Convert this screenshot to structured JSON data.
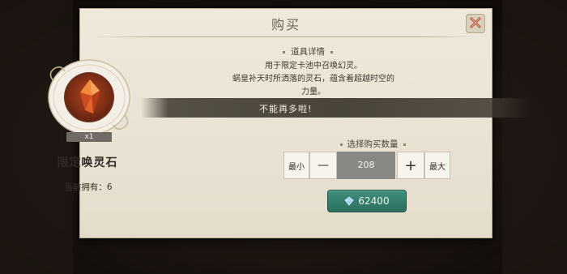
{
  "dialog": {
    "title": "购买",
    "close_icon": "close-x-icon"
  },
  "item": {
    "count_badge": "x1",
    "name": "限定唤灵石",
    "owned_label": "当前拥有：6",
    "icon": "red-crystal-icon"
  },
  "details": {
    "header": "道具详情",
    "description_lines": [
      "用于限定卡池中召唤幻灵。",
      "蜗皇补天时所洒落的灵石，蕴含着超越时空的",
      "力量。"
    ]
  },
  "toast": {
    "message": "不能再多啦!"
  },
  "quantity": {
    "label": "选择购买数量",
    "min_label": "最小",
    "minus_label": "—",
    "value": "208",
    "plus_label": "+",
    "max_label": "最大"
  },
  "purchase": {
    "price": "62400",
    "currency_icon": "gem-icon"
  },
  "colors": {
    "panel": "#ece6d8",
    "buy_button": "#347f6d",
    "toast": "#3c372d"
  }
}
